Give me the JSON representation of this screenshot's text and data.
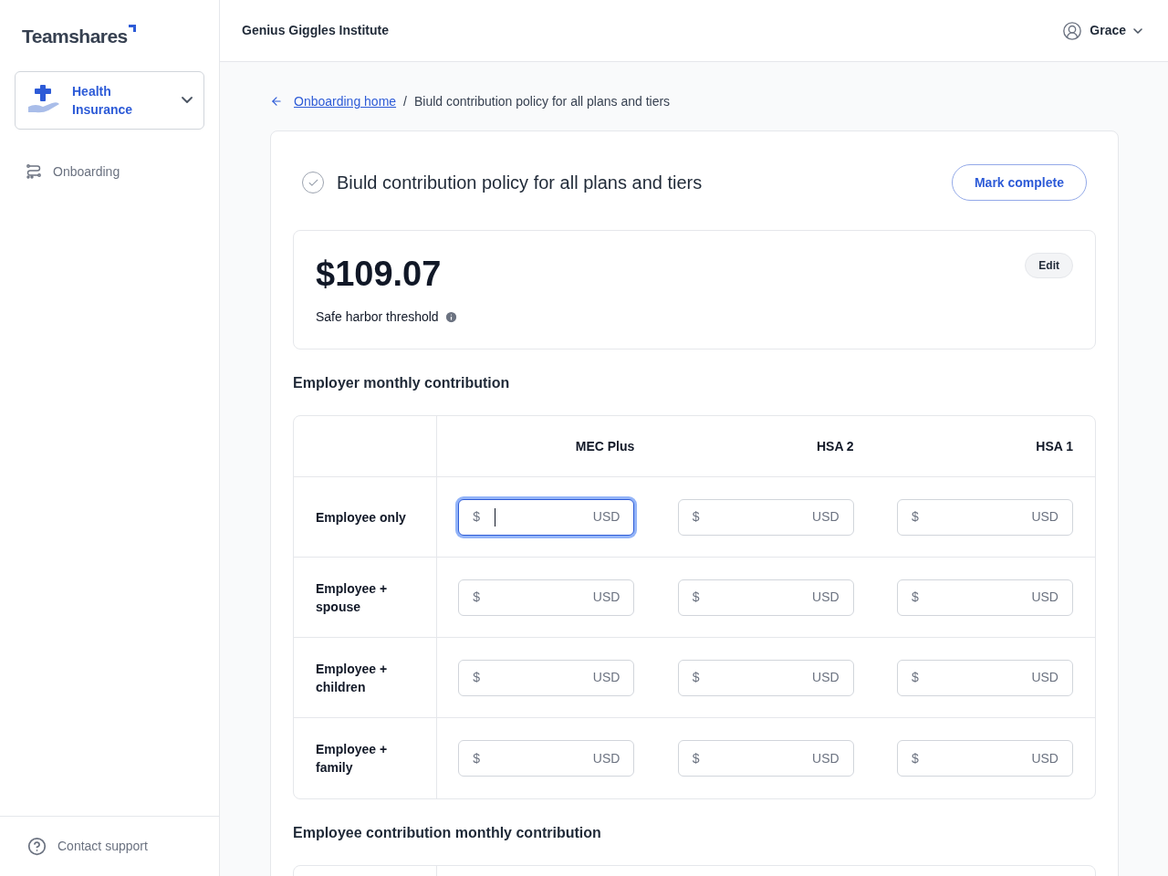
{
  "sidebar": {
    "logo": "Teamshares",
    "product": {
      "line1": "Health",
      "line2": "Insurance"
    },
    "items": [
      {
        "label": "Onboarding",
        "selected": false
      }
    ],
    "footer": "Contact support"
  },
  "header": {
    "org": "Genius Giggles Institute",
    "user": "Grace"
  },
  "breadcrumb": {
    "link": "Onboarding home",
    "separator": "/",
    "current": "Biuld contribution policy for all plans and tiers"
  },
  "task": {
    "title": "Biuld contribution policy for all plans and tiers",
    "completed": false,
    "button": "Mark complete"
  },
  "threshold": {
    "amount": "$109.07",
    "label": "Safe harbor threshold",
    "edit": "Edit"
  },
  "employer": {
    "heading": "Employer monthly contribution",
    "columns": [
      "MEC Plus",
      "HSA 2",
      "HSA 1"
    ],
    "rows": [
      {
        "label": "Employee only",
        "cells": [
          {
            "prefix": "$",
            "suffix": "USD",
            "focused": true
          },
          {
            "prefix": "$",
            "suffix": "USD",
            "focused": false
          },
          {
            "prefix": "$",
            "suffix": "USD",
            "focused": false
          }
        ]
      },
      {
        "label": "Employee + spouse",
        "cells": [
          {
            "prefix": "$",
            "suffix": "USD",
            "focused": false
          },
          {
            "prefix": "$",
            "suffix": "USD",
            "focused": false
          },
          {
            "prefix": "$",
            "suffix": "USD",
            "focused": false
          }
        ]
      },
      {
        "label": "Employee + children",
        "cells": [
          {
            "prefix": "$",
            "suffix": "USD",
            "focused": false
          },
          {
            "prefix": "$",
            "suffix": "USD",
            "focused": false
          },
          {
            "prefix": "$",
            "suffix": "USD",
            "focused": false
          }
        ]
      },
      {
        "label": "Employee + family",
        "cells": [
          {
            "prefix": "$",
            "suffix": "USD",
            "focused": false
          },
          {
            "prefix": "$",
            "suffix": "USD",
            "focused": false
          },
          {
            "prefix": "$",
            "suffix": "USD",
            "focused": false
          }
        ]
      }
    ]
  },
  "employee": {
    "heading": "Employee contribution monthly contribution"
  }
}
